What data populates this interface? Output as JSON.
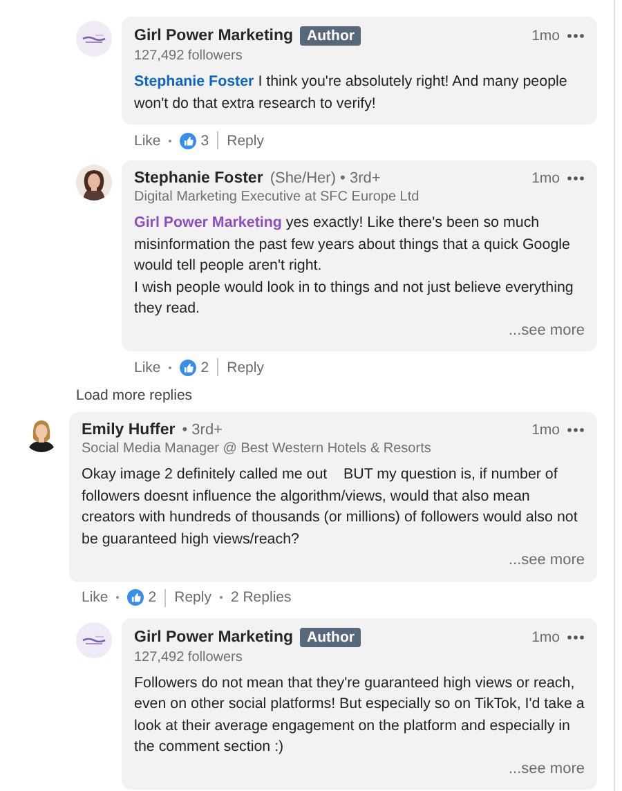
{
  "replies": [
    {
      "kind": "logo",
      "name": "Girl Power Marketing",
      "badge": "Author",
      "subtitle": "127,492 followers",
      "time": "1mo",
      "mention": "Stephanie Foster",
      "mention_visited": false,
      "body": [
        "I think you're absolutely right! And many people won't do that extra research to verify!"
      ],
      "like": "Like",
      "reactions": "3",
      "reply": "Reply"
    },
    {
      "kind": "picture",
      "name": "Stephanie Foster",
      "meta": "(She/Her) • 3rd+",
      "subtitle": "Digital Marketing Executive at SFC Europe Ltd",
      "time": "1mo",
      "mention": "Girl Power Marketing",
      "mention_visited": true,
      "body": [
        "yes exactly! Like there's been so much misinformation the past few years about things that a quick Google would tell people aren't right.",
        "I wish people would look in to things and not just believe everything they read."
      ],
      "see_more": "...see more",
      "like": "Like",
      "reactions": "2",
      "reply": "Reply"
    }
  ],
  "load_more": "Load more replies",
  "comments": [
    {
      "kind": "picture",
      "name": "Emily Huffer",
      "meta": "• 3rd+",
      "subtitle": "Social Media Manager @ Best Western Hotels & Resorts",
      "time": "1mo",
      "body": [
        "Okay image 2 definitely called me out    BUT my question is, if number of followers doesnt influence the algorithm/views, would that also mean creators with hundreds of thousands (or millions) of followers would also not be guaranteed high views/reach?"
      ],
      "see_more": "...see more",
      "like": "Like",
      "reactions": "2",
      "reply": "Reply",
      "replies_count": "2 Replies",
      "children": [
        {
          "kind": "logo",
          "name": "Girl Power Marketing",
          "badge": "Author",
          "subtitle": "127,492 followers",
          "time": "1mo",
          "body": [
            "Followers do not mean that they're guaranteed high views or reach, even on other social platforms! But especially so on TikTok, I'd take a look at their average engagement on the platform and especially in the comment section :)"
          ],
          "see_more": "...see more"
        }
      ]
    }
  ]
}
